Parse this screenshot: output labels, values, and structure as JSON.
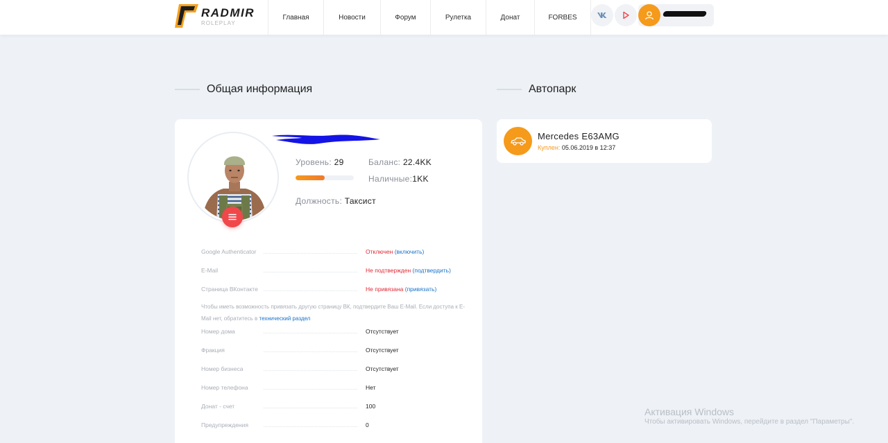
{
  "header": {
    "logo_name": "RADMIR",
    "logo_sub": "ROLEPLAY",
    "nav": [
      {
        "label": "Главная",
        "icon": ""
      },
      {
        "label": "Новости",
        "icon": ""
      },
      {
        "label": "Форум",
        "icon": ""
      },
      {
        "label": "Рулетка",
        "icon": ""
      },
      {
        "label": "Донат",
        "icon": ""
      },
      {
        "label": "FORBES",
        "icon": ""
      }
    ]
  },
  "sections": {
    "general_title": "Общая информация",
    "fleet_title": "Автопарк"
  },
  "profile": {
    "level_label": "Уровень:",
    "level_value": "29",
    "level_progress": 0.5,
    "balance_label": "Баланс:",
    "balance_value": "22.4KK",
    "cash_label": "Наличные:",
    "cash_value": "1KK",
    "position_label": "Должность:",
    "position_value": "Таксист"
  },
  "info": {
    "google_label": "Google Authenticator",
    "google_status": "Отключен",
    "google_action": "(включить)",
    "email_label": "E-Mail",
    "email_status": "Не подтвержден",
    "email_action": "(подтвердить)",
    "vk_label": "Страница ВКонтакте",
    "vk_status": "Не привязана",
    "vk_action": "(привязать)",
    "note_text": "Чтобы иметь возможность привязать другую страницу ВК, подтвердите Ваш E-Mail. Если доступа к E-Mail нет, обратитесь в ",
    "note_link": "технический раздел",
    "rows": [
      {
        "label": "Номер дома",
        "value": "Отсутствует"
      },
      {
        "label": "Фракция",
        "value": "Отсутствует"
      },
      {
        "label": "Номер бизнеса",
        "value": "Отсутствует"
      },
      {
        "label": "Номер телефона",
        "value": "Нет"
      },
      {
        "label": "Донат - счет",
        "value": "100"
      },
      {
        "label": "Предупреждения",
        "value": "0"
      }
    ]
  },
  "car": {
    "name": "Mercedes E63AMG",
    "bought_label": "Куплен:",
    "bought_date": "05.06.2019 в 12:37"
  },
  "watermark": {
    "title": "Активация Windows",
    "text": "Чтобы активировать Windows, перейдите в раздел \"Параметры\"."
  },
  "colors": {
    "accent_orange": "#f59a1b",
    "menu_red": "#f0474b",
    "status_red": "#e02a35",
    "link_blue": "#1a73c9"
  },
  "icons": {
    "vk": "vk-icon",
    "play": "play-icon",
    "user": "user-icon",
    "menu": "hamburger-icon",
    "car": "car-icon"
  }
}
